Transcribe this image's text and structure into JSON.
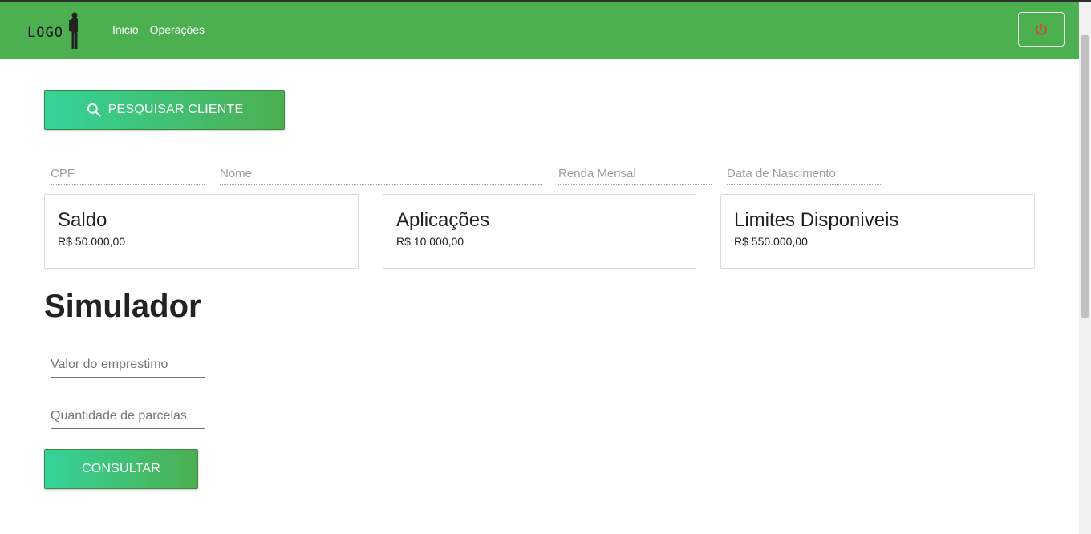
{
  "navbar": {
    "logo_text": "LOGO",
    "links": [
      "Inicio",
      "Operações"
    ],
    "power_icon": "power-icon",
    "background_color": "#4caf50"
  },
  "search": {
    "button_label": "PESQUISAR CLIENTE",
    "icon": "search-icon"
  },
  "client_fields": {
    "cpf": "CPF",
    "nome": "Nome",
    "renda": "Renda Mensal",
    "nascimento": "Data de Nascimento"
  },
  "cards": [
    {
      "title": "Saldo",
      "value": "R$ 50.000,00"
    },
    {
      "title": "Aplicações",
      "value": "R$ 10.000,00"
    },
    {
      "title": "Limites Disponiveis",
      "value": "R$ 550.000,00"
    }
  ],
  "simulator": {
    "title": "Simulador",
    "valor_placeholder": "Valor do emprestimo",
    "parcelas_placeholder": "Quantidade de parcelas",
    "consult_label": "CONSULTAR"
  }
}
